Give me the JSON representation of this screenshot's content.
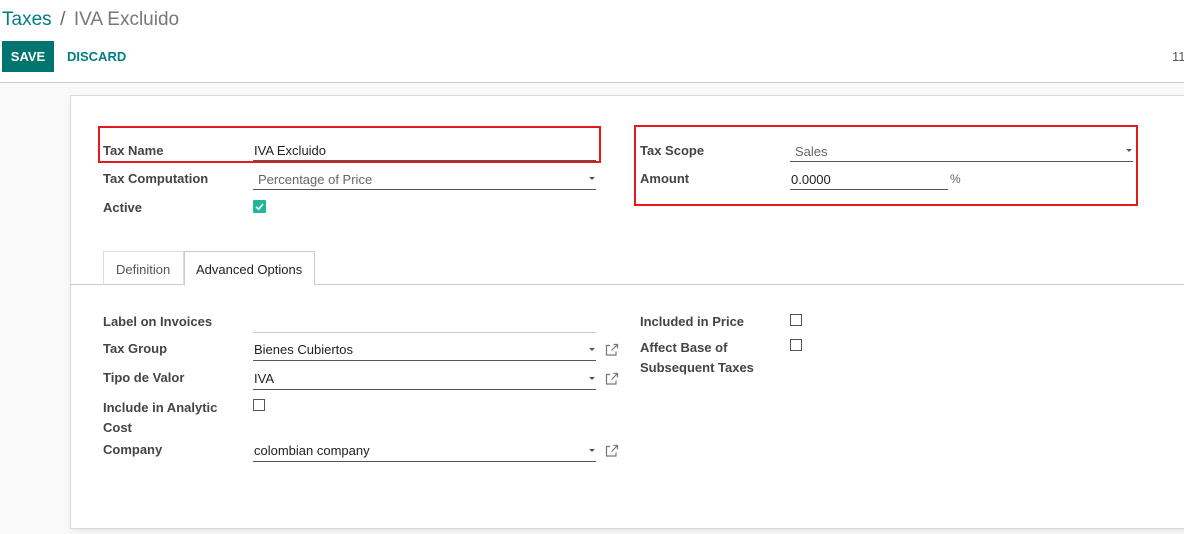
{
  "breadcrumb": {
    "parent": "Taxes",
    "separator": "/",
    "current": "IVA Excluido"
  },
  "toolbar": {
    "save_label": "SAVE",
    "discard_label": "DISCARD",
    "pager_text": "11"
  },
  "form": {
    "tax_name_label": "Tax Name",
    "tax_name_value": "IVA Excluido",
    "tax_computation_label": "Tax Computation",
    "tax_computation_value": "Percentage of Price",
    "active_label": "Active",
    "active_checked": true,
    "tax_scope_label": "Tax Scope",
    "tax_scope_value": "Sales",
    "amount_label": "Amount",
    "amount_value": "0.0000",
    "amount_unit": "%"
  },
  "tabs": [
    {
      "label": "Definition",
      "active": false
    },
    {
      "label": "Advanced Options",
      "active": true
    }
  ],
  "advanced": {
    "label_on_invoices_label": "Label on Invoices",
    "label_on_invoices_value": "",
    "tax_group_label": "Tax Group",
    "tax_group_value": "Bienes Cubiertos",
    "tipo_de_valor_label": "Tipo de Valor",
    "tipo_de_valor_value": "IVA",
    "include_analytic_line1": "Include in Analytic",
    "include_analytic_line2": "Cost",
    "include_analytic_checked": false,
    "company_label": "Company",
    "company_value": "colombian company",
    "included_in_price_label": "Included in Price",
    "included_in_price_checked": false,
    "affect_base_line1": "Affect Base of",
    "affect_base_line2": "Subsequent Taxes",
    "affect_base_checked": false
  },
  "colors": {
    "accent": "#017e84",
    "save_bg": "#00756f",
    "highlight": "#e5191c",
    "check_on": "#21b799"
  },
  "icons": {
    "external_link": "external-link-icon",
    "dropdown": "caret-down-icon",
    "check": "check-icon"
  }
}
